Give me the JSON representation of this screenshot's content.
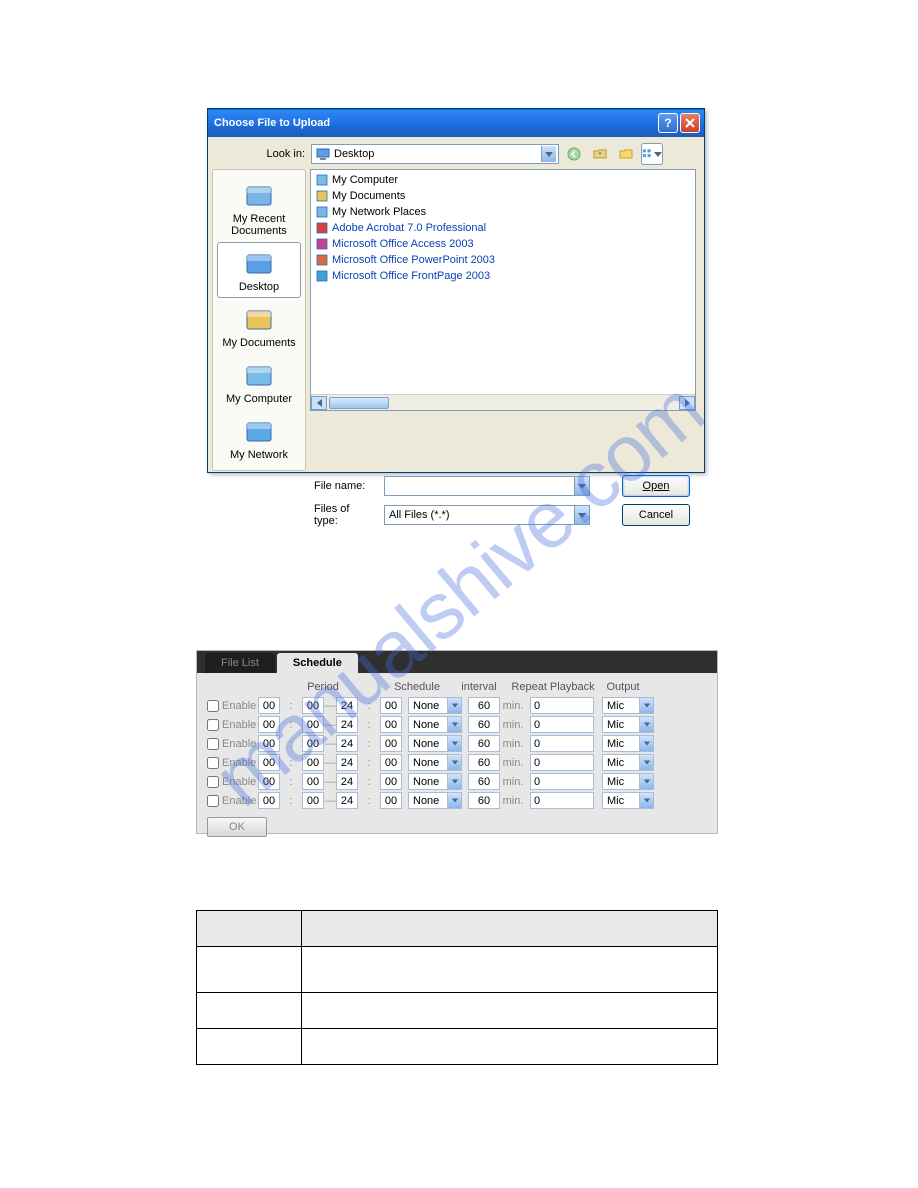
{
  "watermark": "manualshive.com",
  "dialog": {
    "title": "Choose File to Upload",
    "lookin_label": "Look in:",
    "lookin_value": "Desktop",
    "places": [
      {
        "label": "My Recent Documents",
        "icon_color": "#7ab5e8",
        "selected": false
      },
      {
        "label": "Desktop",
        "icon_color": "#5a9ee8",
        "selected": true
      },
      {
        "label": "My Documents",
        "icon_color": "#e8c45a",
        "selected": false
      },
      {
        "label": "My Computer",
        "icon_color": "#7abce8",
        "selected": false
      },
      {
        "label": "My Network",
        "icon_color": "#5aa8e8",
        "selected": false
      }
    ],
    "files": [
      {
        "name": "My Computer",
        "is_link": false,
        "color": "#7abce8"
      },
      {
        "name": "My Documents",
        "is_link": false,
        "color": "#e8c45a"
      },
      {
        "name": "My Network Places",
        "is_link": false,
        "color": "#7ab5e8"
      },
      {
        "name": "Adobe Acrobat 7.0 Professional",
        "is_link": true,
        "color": "#d84040"
      },
      {
        "name": "Microsoft Office Access 2003",
        "is_link": true,
        "color": "#c84090"
      },
      {
        "name": "Microsoft Office PowerPoint 2003",
        "is_link": true,
        "color": "#d86a40"
      },
      {
        "name": "Microsoft Office FrontPage 2003",
        "is_link": true,
        "color": "#40a0d8"
      }
    ],
    "filename_label": "File name:",
    "filename_value": "",
    "filetype_label": "Files of type:",
    "filetype_value": "All Files (*.*)",
    "open_label": "Open",
    "cancel_label": "Cancel"
  },
  "schedule": {
    "tab_filelist": "File List",
    "tab_schedule": "Schedule",
    "headers": {
      "period": "Period",
      "schedule": "Schedule",
      "interval": "interval",
      "repeat": "Repeat Playback",
      "output": "Output"
    },
    "enable_label": "Enable",
    "min_label": "min.",
    "ok_label": "OK",
    "rows": [
      {
        "start_h": "00",
        "start_m": "00",
        "end_h": "24",
        "end_m": "00",
        "sched": "None",
        "interval": "60",
        "repeat": "0",
        "output": "Mic"
      },
      {
        "start_h": "00",
        "start_m": "00",
        "end_h": "24",
        "end_m": "00",
        "sched": "None",
        "interval": "60",
        "repeat": "0",
        "output": "Mic"
      },
      {
        "start_h": "00",
        "start_m": "00",
        "end_h": "24",
        "end_m": "00",
        "sched": "None",
        "interval": "60",
        "repeat": "0",
        "output": "Mic"
      },
      {
        "start_h": "00",
        "start_m": "00",
        "end_h": "24",
        "end_m": "00",
        "sched": "None",
        "interval": "60",
        "repeat": "0",
        "output": "Mic"
      },
      {
        "start_h": "00",
        "start_m": "00",
        "end_h": "24",
        "end_m": "00",
        "sched": "None",
        "interval": "60",
        "repeat": "0",
        "output": "Mic"
      },
      {
        "start_h": "00",
        "start_m": "00",
        "end_h": "24",
        "end_m": "00",
        "sched": "None",
        "interval": "60",
        "repeat": "0",
        "output": "Mic"
      }
    ]
  }
}
